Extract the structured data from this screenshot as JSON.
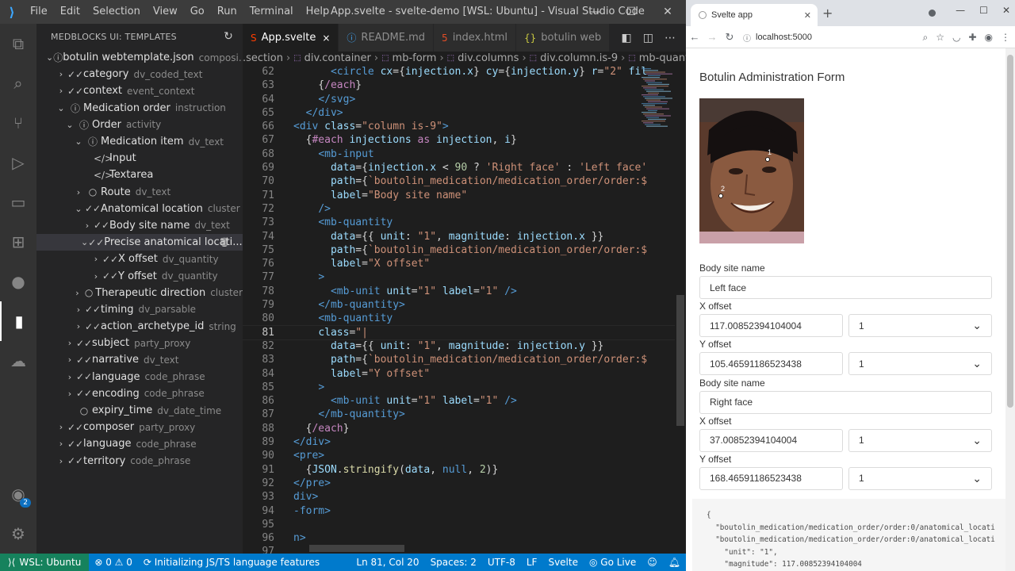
{
  "vscode": {
    "menu": [
      "File",
      "Edit",
      "Selection",
      "View",
      "Go",
      "Run",
      "Terminal",
      "Help"
    ],
    "window_title": "App.svelte - svelte-demo [WSL: Ubuntu] - Visual Studio Code",
    "sidebar_title": "MEDBLOCKS UI: TEMPLATES",
    "tree": [
      {
        "indent": 0,
        "chev": "⌄",
        "icon": "ⓘ",
        "label": "botulin webtemplate.json",
        "type": "composi..."
      },
      {
        "indent": 1,
        "chev": "›",
        "icon": "✓✓",
        "label": "category",
        "type": "dv_coded_text"
      },
      {
        "indent": 1,
        "chev": "›",
        "icon": "✓✓",
        "label": "context",
        "type": "event_context"
      },
      {
        "indent": 1,
        "chev": "⌄",
        "icon": "ⓘ",
        "label": "Medication order",
        "type": "instruction"
      },
      {
        "indent": 2,
        "chev": "⌄",
        "icon": "ⓘ",
        "label": "Order",
        "type": "activity"
      },
      {
        "indent": 3,
        "chev": "⌄",
        "icon": "ⓘ",
        "label": "Medication item",
        "type": "dv_text"
      },
      {
        "indent": 4,
        "chev": "",
        "icon": "</>",
        "label": "Input",
        "type": ""
      },
      {
        "indent": 4,
        "chev": "",
        "icon": "</>",
        "label": "Textarea",
        "type": ""
      },
      {
        "indent": 3,
        "chev": "›",
        "icon": "○",
        "label": "Route",
        "type": "dv_text"
      },
      {
        "indent": 3,
        "chev": "⌄",
        "icon": "✓✓",
        "label": "Anatomical location",
        "type": "cluster"
      },
      {
        "indent": 4,
        "chev": "›",
        "icon": "✓✓",
        "label": "Body site name",
        "type": "dv_text"
      },
      {
        "indent": 4,
        "chev": "⌄",
        "icon": "✓✓",
        "label": "Precise anatomical locati...",
        "type": "",
        "selected": true
      },
      {
        "indent": 5,
        "chev": "›",
        "icon": "✓✓",
        "label": "X offset",
        "type": "dv_quantity"
      },
      {
        "indent": 5,
        "chev": "›",
        "icon": "✓✓",
        "label": "Y offset",
        "type": "dv_quantity"
      },
      {
        "indent": 3,
        "chev": "›",
        "icon": "○",
        "label": "Therapeutic direction",
        "type": "cluster"
      },
      {
        "indent": 3,
        "chev": "›",
        "icon": "✓✓",
        "label": "timing",
        "type": "dv_parsable"
      },
      {
        "indent": 3,
        "chev": "›",
        "icon": "✓✓",
        "label": "action_archetype_id",
        "type": "string"
      },
      {
        "indent": 2,
        "chev": "›",
        "icon": "✓✓",
        "label": "subject",
        "type": "party_proxy"
      },
      {
        "indent": 2,
        "chev": "›",
        "icon": "✓✓",
        "label": "narrative",
        "type": "dv_text"
      },
      {
        "indent": 2,
        "chev": "›",
        "icon": "✓✓",
        "label": "language",
        "type": "code_phrase"
      },
      {
        "indent": 2,
        "chev": "›",
        "icon": "✓✓",
        "label": "encoding",
        "type": "code_phrase"
      },
      {
        "indent": 2,
        "chev": "",
        "icon": "○",
        "label": "expiry_time",
        "type": "dv_date_time"
      },
      {
        "indent": 1,
        "chev": "›",
        "icon": "✓✓",
        "label": "composer",
        "type": "party_proxy"
      },
      {
        "indent": 1,
        "chev": "›",
        "icon": "✓✓",
        "label": "language",
        "type": "code_phrase"
      },
      {
        "indent": 1,
        "chev": "›",
        "icon": "✓✓",
        "label": "territory",
        "type": "code_phrase"
      }
    ],
    "tabs": [
      {
        "icon": "S",
        "label": "App.svelte",
        "active": true,
        "close": "×",
        "color": "#ff3e00"
      },
      {
        "icon": "ⓘ",
        "label": "README.md",
        "active": false,
        "close": "",
        "color": "#42a5f5"
      },
      {
        "icon": "5",
        "label": "index.html",
        "active": false,
        "close": "",
        "color": "#e44d26"
      },
      {
        "icon": "{}",
        "label": "botulin web",
        "active": false,
        "close": "",
        "color": "#cbcb41"
      }
    ],
    "breadcrumbs": [
      ".section",
      "div.container",
      "mb-form",
      "div.columns",
      "div.column.is-9",
      "mb-quantity"
    ],
    "current_line": 81,
    "code": [
      {
        "n": 62,
        "tokens": [
          [
            "t-txt",
            "      "
          ],
          [
            "t-tag",
            "<circle "
          ],
          [
            "t-attr",
            "cx"
          ],
          [
            "t-txt",
            "={"
          ],
          [
            "t-attr",
            "injection.x"
          ],
          [
            "t-txt",
            "} "
          ],
          [
            "t-attr",
            "cy"
          ],
          [
            "t-txt",
            "={"
          ],
          [
            "t-attr",
            "injection.y"
          ],
          [
            "t-txt",
            "} "
          ],
          [
            "t-attr",
            "r"
          ],
          [
            "t-txt",
            "="
          ],
          [
            "t-str",
            "\"2\""
          ],
          [
            "t-attr",
            " fil"
          ]
        ]
      },
      {
        "n": 63,
        "tokens": [
          [
            "t-txt",
            "    {"
          ],
          [
            "t-kw",
            "/each"
          ],
          [
            "t-txt",
            "}"
          ]
        ]
      },
      {
        "n": 64,
        "tokens": [
          [
            "t-txt",
            "    "
          ],
          [
            "t-tag",
            "</svg>"
          ]
        ]
      },
      {
        "n": 65,
        "tokens": [
          [
            "t-txt",
            "  "
          ],
          [
            "t-tag",
            "</div>"
          ]
        ]
      },
      {
        "n": 66,
        "tokens": [
          [
            "t-tag",
            "<div "
          ],
          [
            "t-attr",
            "class"
          ],
          [
            "t-txt",
            "="
          ],
          [
            "t-str",
            "\"column is-9\""
          ],
          [
            "t-tag",
            ">"
          ]
        ]
      },
      {
        "n": 67,
        "tokens": [
          [
            "t-txt",
            "  {"
          ],
          [
            "t-kw",
            "#each "
          ],
          [
            "t-attr",
            "injections "
          ],
          [
            "t-kw",
            "as "
          ],
          [
            "t-attr",
            "injection"
          ],
          [
            "t-txt",
            ", "
          ],
          [
            "t-attr",
            "i"
          ],
          [
            "t-txt",
            "}"
          ]
        ]
      },
      {
        "n": 68,
        "tokens": [
          [
            "t-txt",
            "    "
          ],
          [
            "t-tag",
            "<mb-input"
          ]
        ]
      },
      {
        "n": 69,
        "tokens": [
          [
            "t-txt",
            "      "
          ],
          [
            "t-attr",
            "data"
          ],
          [
            "t-txt",
            "={"
          ],
          [
            "t-attr",
            "injection.x"
          ],
          [
            "t-txt",
            " < "
          ],
          [
            "t-num",
            "90"
          ],
          [
            "t-txt",
            " ? "
          ],
          [
            "t-str",
            "'Right face'"
          ],
          [
            "t-txt",
            " : "
          ],
          [
            "t-str",
            "'Left face'"
          ]
        ]
      },
      {
        "n": 70,
        "tokens": [
          [
            "t-txt",
            "      "
          ],
          [
            "t-attr",
            "path"
          ],
          [
            "t-txt",
            "={"
          ],
          [
            "t-str",
            "`boutolin_medication/medication_order/order:$"
          ]
        ]
      },
      {
        "n": 71,
        "tokens": [
          [
            "t-txt",
            "      "
          ],
          [
            "t-attr",
            "label"
          ],
          [
            "t-txt",
            "="
          ],
          [
            "t-str",
            "\"Body site name\""
          ]
        ]
      },
      {
        "n": 72,
        "tokens": [
          [
            "t-txt",
            "    "
          ],
          [
            "t-tag",
            "/>"
          ]
        ]
      },
      {
        "n": 73,
        "tokens": [
          [
            "t-txt",
            "    "
          ],
          [
            "t-tag",
            "<mb-quantity"
          ]
        ]
      },
      {
        "n": 74,
        "tokens": [
          [
            "t-txt",
            "      "
          ],
          [
            "t-attr",
            "data"
          ],
          [
            "t-txt",
            "={{ "
          ],
          [
            "t-attr",
            "unit"
          ],
          [
            "t-txt",
            ": "
          ],
          [
            "t-str",
            "\"1\""
          ],
          [
            "t-txt",
            ", "
          ],
          [
            "t-attr",
            "magnitude"
          ],
          [
            "t-txt",
            ": "
          ],
          [
            "t-attr",
            "injection.x"
          ],
          [
            "t-txt",
            " }}"
          ]
        ]
      },
      {
        "n": 75,
        "tokens": [
          [
            "t-txt",
            "      "
          ],
          [
            "t-attr",
            "path"
          ],
          [
            "t-txt",
            "={"
          ],
          [
            "t-str",
            "`boutolin_medication/medication_order/order:$"
          ]
        ]
      },
      {
        "n": 76,
        "tokens": [
          [
            "t-txt",
            "      "
          ],
          [
            "t-attr",
            "label"
          ],
          [
            "t-txt",
            "="
          ],
          [
            "t-str",
            "\"X offset\""
          ]
        ]
      },
      {
        "n": 77,
        "tokens": [
          [
            "t-txt",
            "    "
          ],
          [
            "t-tag",
            ">"
          ]
        ]
      },
      {
        "n": 78,
        "tokens": [
          [
            "t-txt",
            "      "
          ],
          [
            "t-tag",
            "<mb-unit "
          ],
          [
            "t-attr",
            "unit"
          ],
          [
            "t-txt",
            "="
          ],
          [
            "t-str",
            "\"1\""
          ],
          [
            "t-txt",
            " "
          ],
          [
            "t-attr",
            "label"
          ],
          [
            "t-txt",
            "="
          ],
          [
            "t-str",
            "\"1\""
          ],
          [
            "t-txt",
            " "
          ],
          [
            "t-tag",
            "/>"
          ]
        ]
      },
      {
        "n": 79,
        "tokens": [
          [
            "t-txt",
            "    "
          ],
          [
            "t-tag",
            "</mb-quantity>"
          ]
        ]
      },
      {
        "n": 80,
        "tokens": [
          [
            "t-txt",
            "    "
          ],
          [
            "t-tag",
            "<mb-quantity"
          ]
        ]
      },
      {
        "n": 81,
        "tokens": [
          [
            "t-txt",
            "    "
          ],
          [
            "t-attr",
            "class"
          ],
          [
            "t-txt",
            "="
          ],
          [
            "t-str",
            "\"|"
          ]
        ]
      },
      {
        "n": 82,
        "tokens": [
          [
            "t-txt",
            "      "
          ],
          [
            "t-attr",
            "data"
          ],
          [
            "t-txt",
            "={{ "
          ],
          [
            "t-attr",
            "unit"
          ],
          [
            "t-txt",
            ": "
          ],
          [
            "t-str",
            "\"1\""
          ],
          [
            "t-txt",
            ", "
          ],
          [
            "t-attr",
            "magnitude"
          ],
          [
            "t-txt",
            ": "
          ],
          [
            "t-attr",
            "injection.y"
          ],
          [
            "t-txt",
            " }}"
          ]
        ]
      },
      {
        "n": 83,
        "tokens": [
          [
            "t-txt",
            "      "
          ],
          [
            "t-attr",
            "path"
          ],
          [
            "t-txt",
            "={"
          ],
          [
            "t-str",
            "`boutolin_medication/medication_order/order:$"
          ]
        ]
      },
      {
        "n": 84,
        "tokens": [
          [
            "t-txt",
            "      "
          ],
          [
            "t-attr",
            "label"
          ],
          [
            "t-txt",
            "="
          ],
          [
            "t-str",
            "\"Y offset\""
          ]
        ]
      },
      {
        "n": 85,
        "tokens": [
          [
            "t-txt",
            "    "
          ],
          [
            "t-tag",
            ">"
          ]
        ]
      },
      {
        "n": 86,
        "tokens": [
          [
            "t-txt",
            "      "
          ],
          [
            "t-tag",
            "<mb-unit "
          ],
          [
            "t-attr",
            "unit"
          ],
          [
            "t-txt",
            "="
          ],
          [
            "t-str",
            "\"1\""
          ],
          [
            "t-txt",
            " "
          ],
          [
            "t-attr",
            "label"
          ],
          [
            "t-txt",
            "="
          ],
          [
            "t-str",
            "\"1\""
          ],
          [
            "t-txt",
            " "
          ],
          [
            "t-tag",
            "/>"
          ]
        ]
      },
      {
        "n": 87,
        "tokens": [
          [
            "t-txt",
            "    "
          ],
          [
            "t-tag",
            "</mb-quantity>"
          ]
        ]
      },
      {
        "n": 88,
        "tokens": [
          [
            "t-txt",
            "  {"
          ],
          [
            "t-kw",
            "/each"
          ],
          [
            "t-txt",
            "}"
          ]
        ]
      },
      {
        "n": 89,
        "tokens": [
          [
            "t-tag",
            "</div>"
          ]
        ]
      },
      {
        "n": 90,
        "tokens": [
          [
            "t-tag",
            "<pre>"
          ]
        ]
      },
      {
        "n": 91,
        "tokens": [
          [
            "t-txt",
            "  {"
          ],
          [
            "t-attr",
            "JSON"
          ],
          [
            "t-txt",
            "."
          ],
          [
            "t-fn",
            "stringify"
          ],
          [
            "t-txt",
            "("
          ],
          [
            "t-attr",
            "data"
          ],
          [
            "t-txt",
            ", "
          ],
          [
            "t-tag",
            "null"
          ],
          [
            "t-txt",
            ", "
          ],
          [
            "t-num",
            "2"
          ],
          [
            "t-txt",
            ")}"
          ]
        ]
      },
      {
        "n": 92,
        "tokens": [
          [
            "t-tag",
            "</pre>"
          ]
        ]
      },
      {
        "n": 93,
        "tokens": [
          [
            "t-tag",
            "div>"
          ]
        ]
      },
      {
        "n": 94,
        "tokens": [
          [
            "t-tag",
            "-form>"
          ]
        ]
      },
      {
        "n": 95,
        "tokens": []
      },
      {
        "n": 96,
        "tokens": [
          [
            "t-tag",
            "n>"
          ]
        ]
      },
      {
        "n": 97,
        "tokens": []
      }
    ],
    "status": {
      "remote": "WSL: Ubuntu",
      "problems": "⊗ 0 ⚠ 0",
      "task": "Initializing JS/TS language features",
      "position": "Ln 81, Col 20",
      "spaces": "Spaces: 2",
      "encoding": "UTF-8",
      "eol": "LF",
      "language": "Svelte",
      "golive": "Go Live"
    },
    "accounts_badge": "2"
  },
  "chrome": {
    "tab_title": "Svelte app",
    "url": "localhost:5000",
    "page": {
      "title": "Botulin Administration Form",
      "marker_labels": [
        "1",
        "2"
      ],
      "entries": [
        {
          "site_label": "Body site name",
          "site_value": "Left face",
          "x_label": "X offset",
          "x_value": "117.00852394104004",
          "x_unit": "1",
          "y_label": "Y offset",
          "y_value": "105.46591186523438",
          "y_unit": "1"
        },
        {
          "site_label": "Body site name",
          "site_value": "Right face",
          "x_label": "X offset",
          "x_value": "37.00852394104004",
          "x_unit": "1",
          "y_label": "Y offset",
          "y_value": "168.46591186523438",
          "y_unit": "1"
        }
      ],
      "json_output": "{\n  \"boutolin_medication/medication_order/order:0/anatomical_locati\n  \"boutolin_medication/medication_order/order:0/anatomical_locati\n    \"unit\": \"1\",\n    \"magnitude\": 117.00852394104004"
    }
  }
}
